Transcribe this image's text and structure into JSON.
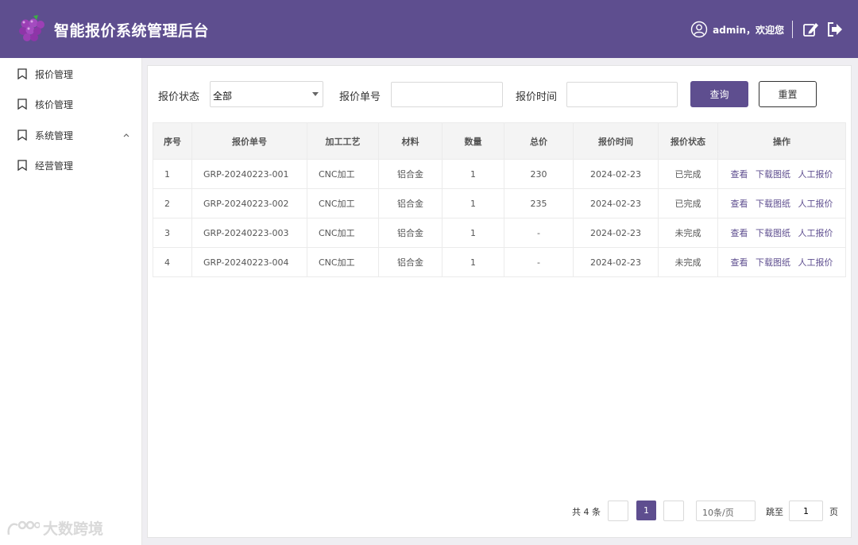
{
  "app": {
    "title": "智能报价系统管理后台",
    "welcome": "admin，欢迎您",
    "accent": "#5e4e8f"
  },
  "header_icons": {
    "user": "user-circle-icon",
    "edit": "edit-icon",
    "logout": "logout-icon"
  },
  "sidebar": {
    "items": [
      {
        "label": "报价管理",
        "icon": "bookmark-icon"
      },
      {
        "label": "核价管理",
        "icon": "bookmark-icon"
      },
      {
        "label": "系统管理",
        "icon": "bookmark-icon",
        "expand_icon": "chevron-up-icon"
      },
      {
        "label": "经营管理",
        "icon": "bookmark-icon"
      }
    ]
  },
  "watermark": {
    "text": "大数跨境"
  },
  "filters": {
    "status_label": "报价状态",
    "status_value": "全部",
    "order_label": "报价单号",
    "order_value": "",
    "time_label": "报价时间",
    "time_value": "",
    "query_button": "查询",
    "reset_button": "重置"
  },
  "table": {
    "columns": [
      "序号",
      "报价单号",
      "加工工艺",
      "材料",
      "数量",
      "总价",
      "报价时间",
      "报价状态",
      "操作"
    ],
    "rows": [
      {
        "no": "1",
        "order": "GRP-20240223-001",
        "craft": "CNC加工",
        "material": "铝合金",
        "qty": "1",
        "total": "230",
        "time": "2024-02-23",
        "status": "已完成"
      },
      {
        "no": "2",
        "order": "GRP-20240223-002",
        "craft": "CNC加工",
        "material": "铝合金",
        "qty": "1",
        "total": "235",
        "time": "2024-02-23",
        "status": "已完成"
      },
      {
        "no": "3",
        "order": "GRP-20240223-003",
        "craft": "CNC加工",
        "material": "铝合金",
        "qty": "1",
        "total": "-",
        "time": "2024-02-23",
        "status": "未完成"
      },
      {
        "no": "4",
        "order": "GRP-20240223-004",
        "craft": "CNC加工",
        "material": "铝合金",
        "qty": "1",
        "total": "-",
        "time": "2024-02-23",
        "status": "未完成"
      }
    ],
    "actions": [
      "查看",
      "下载图纸",
      "人工报价"
    ]
  },
  "pagination": {
    "total_text": "共 4 条",
    "current_page": "1",
    "page_size": "10条/页",
    "jump_label": "跳至",
    "jump_value": "1",
    "page_label": "页"
  }
}
